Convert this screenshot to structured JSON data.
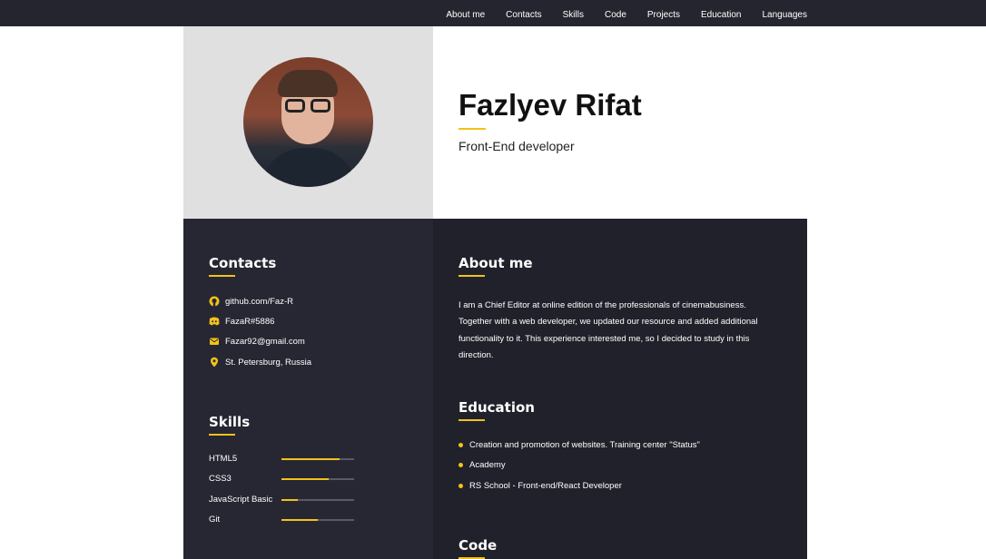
{
  "nav": {
    "items": [
      "About me",
      "Contacts",
      "Skills",
      "Code",
      "Projects",
      "Education",
      "Languages"
    ]
  },
  "hero": {
    "first_name": "Fazlyev",
    "last_name": " Rifat",
    "position": "Front-End developer"
  },
  "contacts": {
    "title": "Contacts",
    "items": [
      {
        "icon": "github-icon",
        "text": "github.com/Faz-R"
      },
      {
        "icon": "discord-icon",
        "text": "FazaR#5886"
      },
      {
        "icon": "mail-icon",
        "text": "Fazar92@gmail.com"
      },
      {
        "icon": "location-icon",
        "text": "St. Petersburg, Russia"
      }
    ]
  },
  "skills": {
    "title": "Skills",
    "items": [
      {
        "name": "HTML5",
        "level": 0.8
      },
      {
        "name": "CSS3",
        "level": 0.65
      },
      {
        "name": "JavaScript Basic",
        "level": 0.22
      },
      {
        "name": "Git",
        "level": 0.5
      }
    ]
  },
  "about": {
    "title": "About me",
    "text": "I am a Chief Editor at online edition of the professionals of cinemabusiness. Together with a web developer, we updated our resource and added additional functionality to it. This experience interested me, so I decided to study in this direction."
  },
  "education": {
    "title": "Education",
    "items": [
      "Creation and promotion of websites. Training center \"Status\"",
      "Academy",
      "RS School - Front-end/React Developer"
    ]
  },
  "code": {
    "title": "Code"
  },
  "colors": {
    "accent": "#f2c21b",
    "dark": "#25252f",
    "sidebar": "#272733",
    "main": "#21212b",
    "hero_left": "#e0e0e0"
  }
}
